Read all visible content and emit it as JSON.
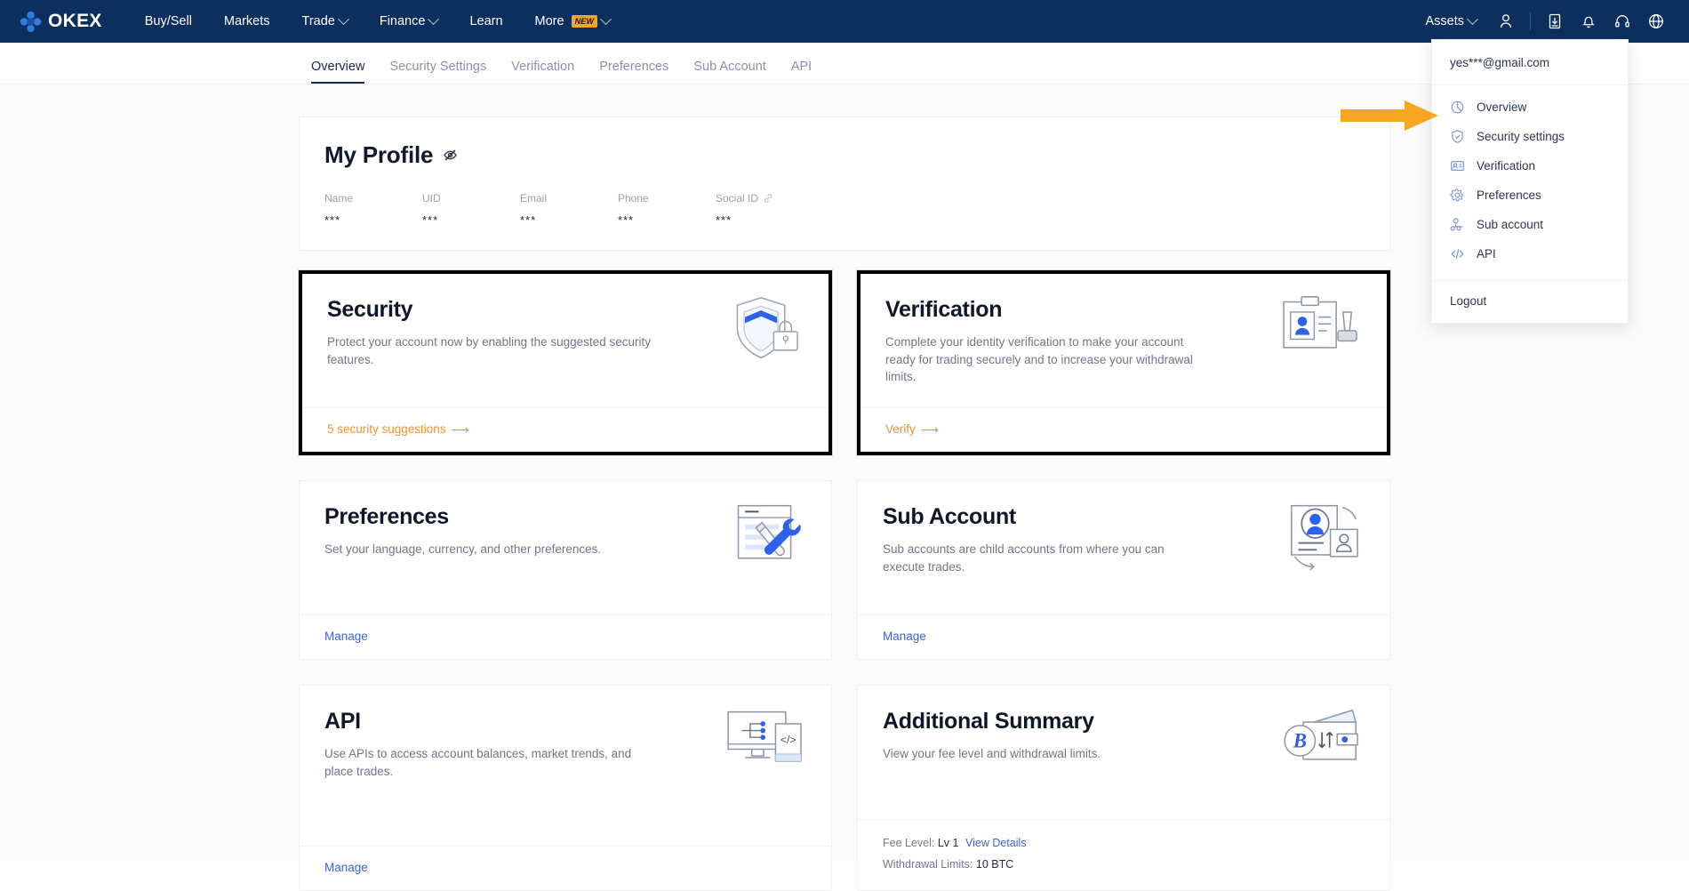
{
  "topnav": {
    "brand": "OKEX",
    "items": [
      {
        "label": "Buy/Sell",
        "caret": false,
        "badge": ""
      },
      {
        "label": "Markets",
        "caret": false,
        "badge": ""
      },
      {
        "label": "Trade",
        "caret": true,
        "badge": ""
      },
      {
        "label": "Finance",
        "caret": true,
        "badge": ""
      },
      {
        "label": "Learn",
        "caret": false,
        "badge": ""
      },
      {
        "label": "More",
        "caret": true,
        "badge": "NEW"
      }
    ],
    "assets_label": "Assets",
    "icons": [
      "user-icon",
      "download-icon",
      "bell-icon",
      "headset-icon",
      "globe-icon"
    ]
  },
  "tabs": [
    {
      "label": "Overview",
      "active": true
    },
    {
      "label": "Security Settings",
      "active": false
    },
    {
      "label": "Verification",
      "active": false
    },
    {
      "label": "Preferences",
      "active": false
    },
    {
      "label": "Sub Account",
      "active": false
    },
    {
      "label": "API",
      "active": false
    }
  ],
  "profile": {
    "title": "My Profile",
    "fields": [
      {
        "label": "Name",
        "value": "***",
        "link_icon": false
      },
      {
        "label": "UID",
        "value": "***",
        "link_icon": false
      },
      {
        "label": "Email",
        "value": "***",
        "link_icon": false
      },
      {
        "label": "Phone",
        "value": "***",
        "link_icon": false
      },
      {
        "label": "Social ID",
        "value": "***",
        "link_icon": true
      }
    ]
  },
  "cards": {
    "security": {
      "title": "Security",
      "desc": "Protect your account now by enabling the suggested security features.",
      "action": "5 security suggestions",
      "action_color": "#f0912d"
    },
    "verification": {
      "title": "Verification",
      "desc": "Complete your identity verification to make your account ready for trading securely and to increase your withdrawal limits.",
      "action": "Verify",
      "action_color": "#f0912d"
    },
    "preferences": {
      "title": "Preferences",
      "desc": "Set your language, currency, and other preferences.",
      "action": "Manage",
      "action_color": "#3b62d9"
    },
    "subaccount": {
      "title": "Sub Account",
      "desc": "Sub accounts are child accounts from where you can execute trades.",
      "action": "Manage",
      "action_color": "#3b62d9"
    },
    "api": {
      "title": "API",
      "desc": "Use APIs to access account balances, market trends, and place trades.",
      "action": "Manage",
      "action_color": "#3b62d9"
    },
    "summary": {
      "title": "Additional Summary",
      "desc": "View your fee level and withdrawal limits.",
      "fee_label": "Fee Level:",
      "fee_value": "Lv 1",
      "fee_link": "View Details",
      "limit_label": "Withdrawal Limits:",
      "limit_value": "10 BTC"
    }
  },
  "dropdown": {
    "email": "yes***@gmail.com",
    "items": [
      {
        "label": "Overview",
        "icon": "pie-chart-icon"
      },
      {
        "label": "Security settings",
        "icon": "shield-check-icon"
      },
      {
        "label": "Verification",
        "icon": "id-card-icon"
      },
      {
        "label": "Preferences",
        "icon": "gear-icon"
      },
      {
        "label": "Sub account",
        "icon": "users-icon"
      },
      {
        "label": "API",
        "icon": "code-icon"
      }
    ],
    "logout": "Logout"
  },
  "annotation": {
    "arrow_color": "#f5a623"
  }
}
